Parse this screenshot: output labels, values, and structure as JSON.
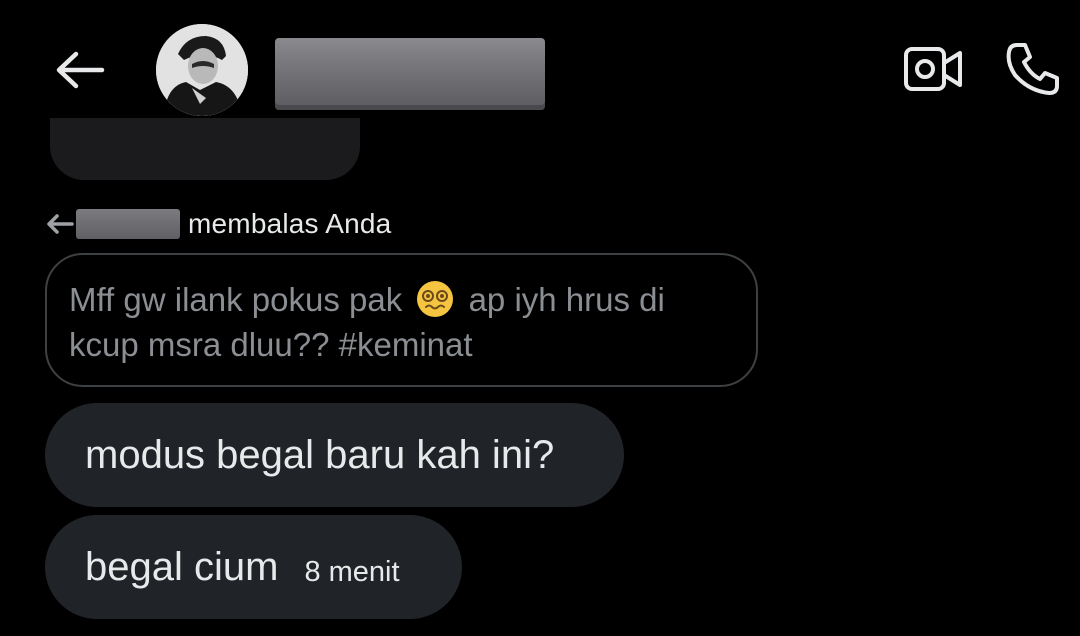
{
  "header": {
    "back_icon": "arrow-left-icon",
    "video_icon": "video-camera-icon",
    "call_icon": "phone-icon"
  },
  "reply": {
    "icon": "reply-arrow-icon",
    "label": "membalas Anda",
    "quoted_text_part1": "Mff gw ilank pokus pak",
    "quoted_emoji": "woozy-face-icon",
    "quoted_text_part2": "ap iyh hrus di kcup msra dluu?? #keminat"
  },
  "messages": [
    {
      "text": "modus begal baru kah ini?"
    },
    {
      "text": "begal cium",
      "timestamp": "8 menit"
    }
  ],
  "colors": {
    "background": "#000000",
    "bubble": "#202327",
    "text": "#e7e9ea",
    "muted_text": "#8b8e92",
    "quote_border": "#3e4144"
  }
}
